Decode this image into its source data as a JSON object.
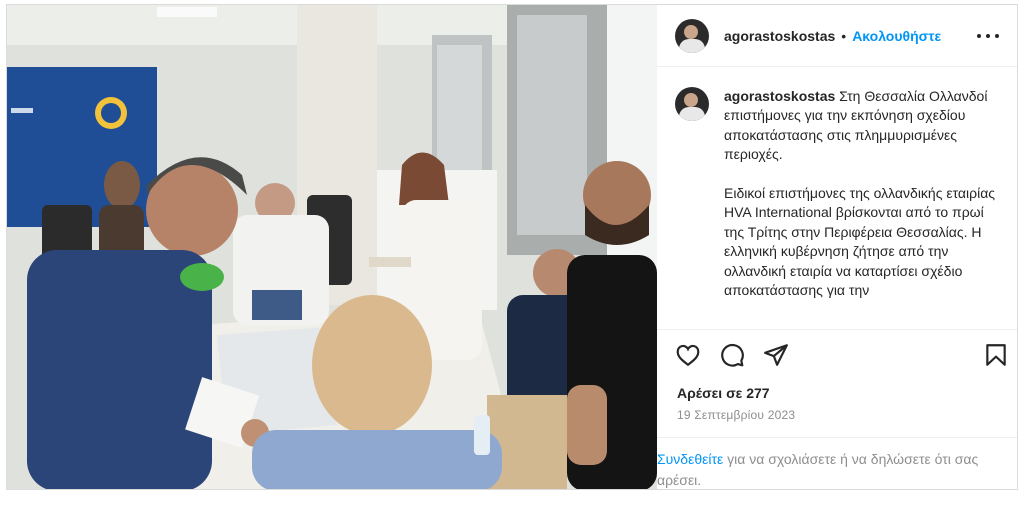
{
  "post": {
    "username": "agorastoskostas",
    "separator": "•",
    "follow_label": "Ακολουθήστε",
    "caption_lead": "Στη Θεσσαλία Ολλανδοί επιστήμονες για την εκπόνηση σχεδίου αποκατάστασης στις πλημμυρισμένες περιοχές.",
    "caption_body": "Ειδικοί επιστήμονες της ολλανδικής εταιρίας HVA International βρίσκονται από το πρωί της Τρίτης στην Περιφέρεια Θεσσαλίας. Η ελληνική κυβέρνηση ζήτησε από την ολλανδική εταιρία να καταρτίσει σχέδιο αποκατάστασης για την",
    "likes": "Αρέσει σε 277",
    "date": "19 Σεπτεμβρίου 2023",
    "login_link": "Συνδεθείτε",
    "login_rest": " για να σχολιάσετε ή να δηλώσετε ότι σας αρέσει."
  },
  "icons": {
    "like": "heart-icon",
    "comment": "comment-icon",
    "share": "share-icon",
    "save": "bookmark-icon",
    "more": "more-options-icon"
  },
  "colors": {
    "link": "#0095f6",
    "muted": "#8e8e8e",
    "text": "#262626",
    "banner": "#1f4e96"
  }
}
